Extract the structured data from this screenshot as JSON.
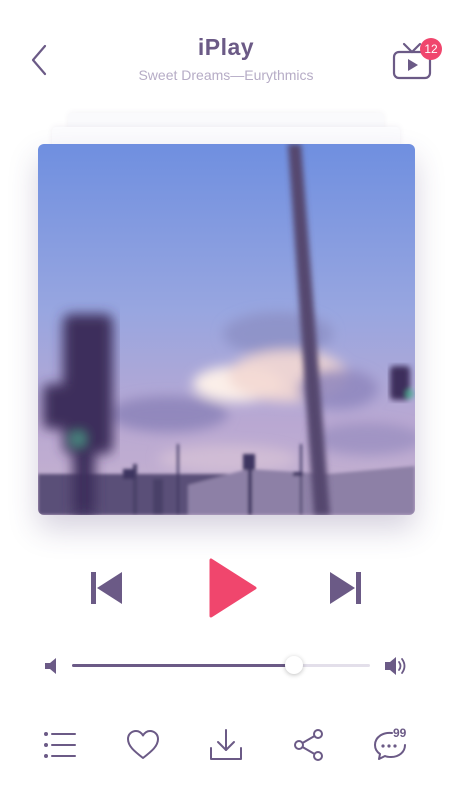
{
  "header": {
    "title": "iPlay",
    "subtitle": "Sweet Dreams—Eurythmics",
    "notification_count": "12"
  },
  "player": {
    "volume_fraction": 0.745
  },
  "bottom_bar": {
    "comment_count": "99"
  },
  "colors": {
    "primary": "#6b5a86",
    "accent": "#f0466d",
    "subtitle": "#b6acc6"
  },
  "icons": [
    "back-chevron-icon",
    "tv-icon",
    "previous-icon",
    "play-icon",
    "next-icon",
    "volume-low-icon",
    "volume-high-icon",
    "playlist-icon",
    "heart-icon",
    "download-icon",
    "share-icon",
    "comment-icon"
  ]
}
